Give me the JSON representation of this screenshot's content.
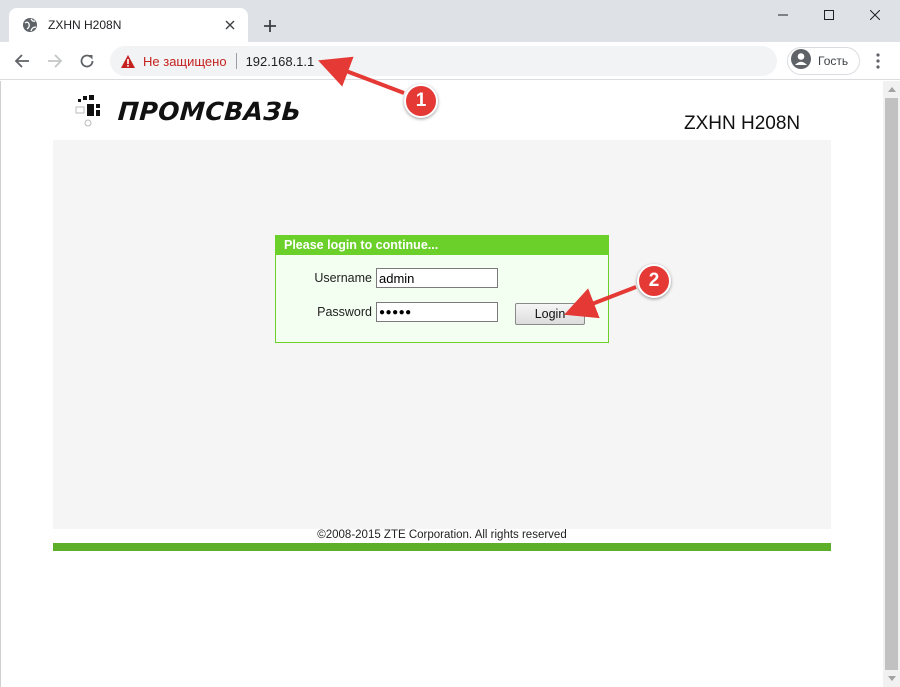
{
  "browser": {
    "tab": {
      "title": "ZXHN H208N",
      "favicon": "globe-icon"
    },
    "new_tab_icon": "plus-icon",
    "window_controls": [
      "minimize-icon",
      "maximize-icon",
      "close-icon"
    ],
    "toolbar": {
      "security_label": "Не защищено",
      "url": "192.168.1.1",
      "profile_label": "Гость"
    }
  },
  "page": {
    "logo_text": "ПРОМСВАЗЬ",
    "model": "ZXHN H208N",
    "login": {
      "header": "Please login to continue...",
      "username_label": "Username",
      "username_value": "admin",
      "password_label": "Password",
      "password_value": "●●●●●",
      "login_button": "Login"
    },
    "footer": "©2008-2015 ZTE Corporation. All rights reserved"
  },
  "annotations": [
    {
      "number": "1",
      "color": "#e53935"
    },
    {
      "number": "2",
      "color": "#e53935"
    }
  ]
}
